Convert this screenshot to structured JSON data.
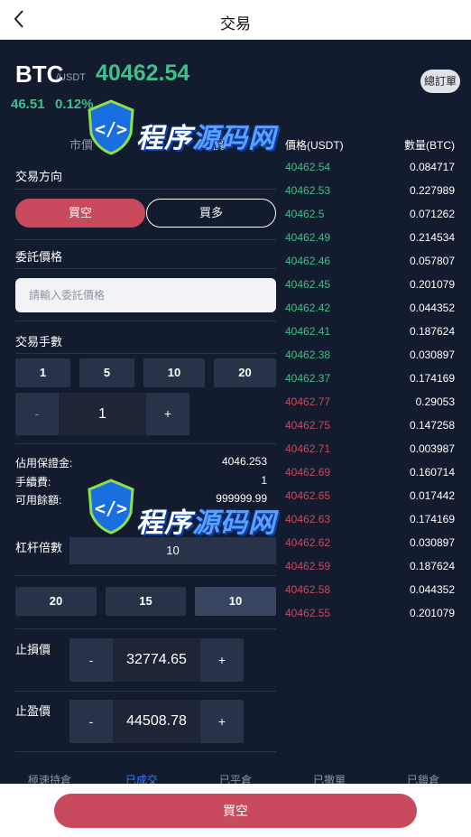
{
  "header": {
    "title": "交易",
    "back_icon": "chevron-left-icon"
  },
  "ticker": {
    "symbol": "BTC",
    "quote": "/USDT",
    "price": "40462.54",
    "change_abs": "46.51",
    "change_pct": "0.12%",
    "orders_button": "總訂單"
  },
  "order_type_tabs": [
    "市價",
    "限價"
  ],
  "direction": {
    "label": "交易方向",
    "sell": "買空",
    "buy": "買多"
  },
  "limit_price": {
    "label": "委託價格",
    "placeholder": "請輸入委託價格"
  },
  "quantity": {
    "label": "交易手數",
    "options": [
      "1",
      "5",
      "10",
      "20"
    ],
    "minus": "-",
    "value": "1",
    "plus": "+"
  },
  "info": {
    "margin_label": "佔用保證金:",
    "margin_value": "4046.253",
    "fee_label": "手續費:",
    "fee_value": "1",
    "balance_label": "可用餘額:",
    "balance_value": "999999.99"
  },
  "leverage": {
    "label": "杠杆倍數",
    "value": "10",
    "options": [
      "20",
      "15",
      "10"
    ]
  },
  "stop_loss": {
    "label": "止損價",
    "minus": "-",
    "value": "32774.65",
    "plus": "+"
  },
  "take_profit": {
    "label": "止盈價",
    "minus": "-",
    "value": "44508.78",
    "plus": "+"
  },
  "orderbook": {
    "price_header": "價格(USDT)",
    "qty_header": "數量(BTC)",
    "rows": [
      {
        "price": "40462.54",
        "qty": "0.084717",
        "side": "buy"
      },
      {
        "price": "40462.53",
        "qty": "0.227989",
        "side": "buy"
      },
      {
        "price": "40462.5",
        "qty": "0.071262",
        "side": "buy"
      },
      {
        "price": "40462.49",
        "qty": "0.214534",
        "side": "buy"
      },
      {
        "price": "40462.46",
        "qty": "0.057807",
        "side": "buy"
      },
      {
        "price": "40462.45",
        "qty": "0.201079",
        "side": "buy"
      },
      {
        "price": "40462.42",
        "qty": "0.044352",
        "side": "buy"
      },
      {
        "price": "40462.41",
        "qty": "0.187624",
        "side": "buy"
      },
      {
        "price": "40462.38",
        "qty": "0.030897",
        "side": "buy"
      },
      {
        "price": "40462.37",
        "qty": "0.174169",
        "side": "buy"
      },
      {
        "price": "40462.77",
        "qty": "0.29053",
        "side": "sell"
      },
      {
        "price": "40462.75",
        "qty": "0.147258",
        "side": "sell"
      },
      {
        "price": "40462.71",
        "qty": "0.003987",
        "side": "sell"
      },
      {
        "price": "40462.69",
        "qty": "0.160714",
        "side": "sell"
      },
      {
        "price": "40462.65",
        "qty": "0.017442",
        "side": "sell"
      },
      {
        "price": "40462.63",
        "qty": "0.174169",
        "side": "sell"
      },
      {
        "price": "40462.62",
        "qty": "0.030897",
        "side": "sell"
      },
      {
        "price": "40462.59",
        "qty": "0.187624",
        "side": "sell"
      },
      {
        "price": "40462.58",
        "qty": "0.044352",
        "side": "sell"
      },
      {
        "price": "40462.55",
        "qty": "0.201079",
        "side": "sell"
      }
    ]
  },
  "bottom_tabs": [
    "極速持倉",
    "已成交",
    "已平倉",
    "已撤單",
    "已鎖倉"
  ],
  "submit_button": "買空",
  "watermark": "程序源码网",
  "colors": {
    "green": "#3fbf8a",
    "red": "#c9495d",
    "bg": "#131b2e",
    "panel": "#283248",
    "accent_blue": "#3d7ef7"
  }
}
